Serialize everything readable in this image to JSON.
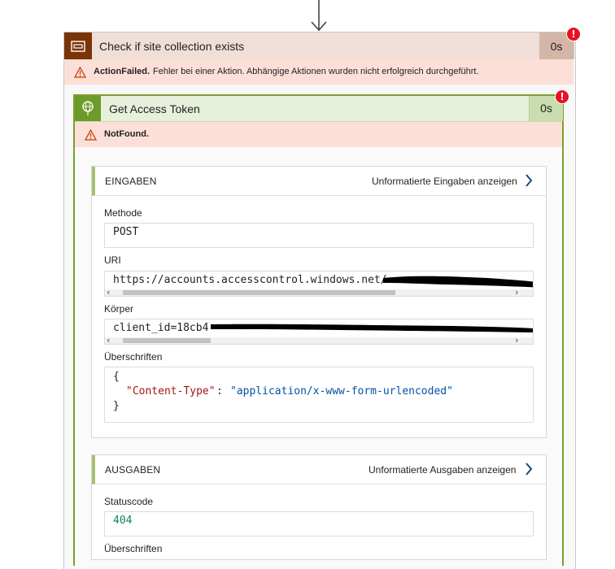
{
  "step": {
    "title": "Check if site collection exists",
    "duration": "0s",
    "error_badge": "!",
    "error_code": "ActionFailed.",
    "error_message": "Fehler bei einer Aktion. Abhängige Aktionen wurden nicht erfolgreich durchgeführt."
  },
  "inner_step": {
    "title": "Get Access Token",
    "duration": "0s",
    "error_badge": "!",
    "error_code": "NotFound."
  },
  "inputs": {
    "title": "EINGABEN",
    "raw_link": "Unformatierte Eingaben anzeigen",
    "method_label": "Methode",
    "method_value": "POST",
    "uri_label": "URI",
    "uri_value": "https://accounts.accesscontrol.windows.net/",
    "body_label": "Körper",
    "body_value": "client_id=18cb4",
    "headers_label": "Überschriften",
    "headers_open": "{",
    "headers_key": "\"Content-Type\"",
    "headers_colon": ": ",
    "headers_value": "\"application/x-www-form-urlencoded\"",
    "headers_close": "}"
  },
  "outputs": {
    "title": "AUSGABEN",
    "raw_link": "Unformatierte Ausgaben anzeigen",
    "status_label": "Statuscode",
    "status_value": "404",
    "headers_label": "Überschriften"
  },
  "colors": {
    "failed_header": "#efdfd8",
    "failed_icon_bg": "#7a3408",
    "error_bg": "#fce0d7",
    "success_header": "#e6f0da",
    "success_accent": "#79a12b",
    "json_key": "#a31515",
    "json_string": "#0451a5",
    "status_code": "#098658"
  }
}
